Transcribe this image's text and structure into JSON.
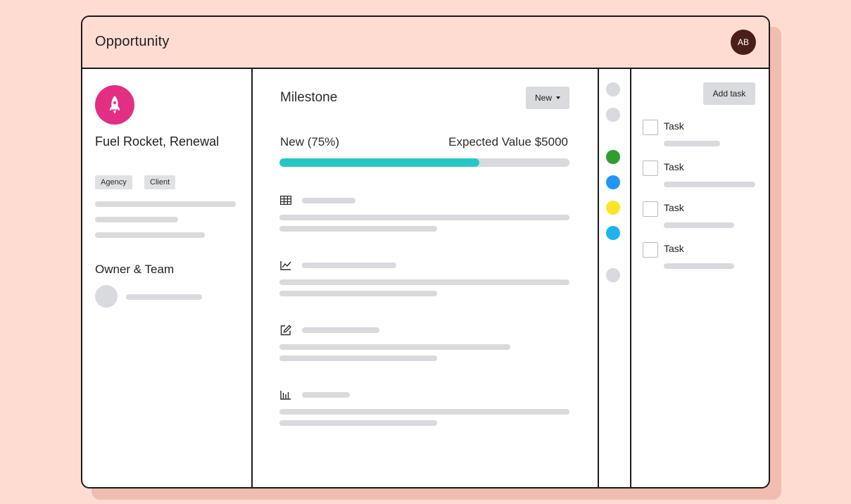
{
  "header": {
    "title": "Opportunity",
    "avatar_initials": "AB"
  },
  "left": {
    "opportunity_name": "Fuel Rocket, Renewal",
    "icon": "rocket-icon",
    "tags": [
      "Agency",
      "Client"
    ],
    "owner_section_title": "Owner & Team"
  },
  "milestone": {
    "title": "Milestone",
    "stage_button": "New",
    "stage_label": "New (75%)",
    "expected_value_label": "Expected Value $5000",
    "progress_fraction": 0.69,
    "progress_color": "#26c6c6",
    "section_icons": [
      "table-icon",
      "line-chart-icon",
      "edit-icon",
      "bar-chart-icon"
    ]
  },
  "timeline_dots": [
    "#d8dadf",
    "#d8dadf",
    "#2e9e2e",
    "#2196f3",
    "#fde428",
    "#1fb3ee",
    "#d8dadf"
  ],
  "tasks": {
    "add_button": "Add task",
    "items": [
      "Task",
      "Task",
      "Task",
      "Task"
    ]
  },
  "colors": {
    "background": "#fedcd2",
    "accent": "#e22f84",
    "border": "#1a1a1a"
  }
}
